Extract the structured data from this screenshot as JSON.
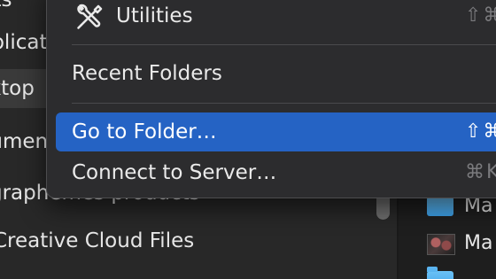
{
  "sidebar": {
    "items": [
      {
        "label": "Recents"
      },
      {
        "label": "Applications"
      },
      {
        "label": "Desktop"
      },
      {
        "label": "Documents"
      },
      {
        "label": "graphemes products"
      },
      {
        "label": "Creative Cloud Files"
      }
    ]
  },
  "menu": {
    "items": [
      {
        "label": "Utilities",
        "shortcut": "⇧⌘U",
        "icon": "tools-icon"
      },
      {
        "label": "Recent Folders",
        "shortcut": ""
      },
      {
        "label": "Go to Folder…",
        "shortcut": "⇧⌘G",
        "highlighted": true
      },
      {
        "label": "Connect to Server…",
        "shortcut": "⌘K"
      }
    ]
  },
  "filelist": {
    "items": [
      {
        "name": "Ma",
        "icon": "folder-icon"
      },
      {
        "name": "Ma",
        "icon": "photo-icon"
      },
      {
        "name": "",
        "icon": "folder-icon"
      }
    ]
  },
  "colors": {
    "menu_bg": "#2c2c2e",
    "highlight": "#2563c4",
    "sidebar_bg": "#282828",
    "selected_row": "#3a3a3a",
    "text": "#eaeaea",
    "shortcut_dim": "#7b7b7e",
    "folder_blue": "#4aaef0"
  }
}
